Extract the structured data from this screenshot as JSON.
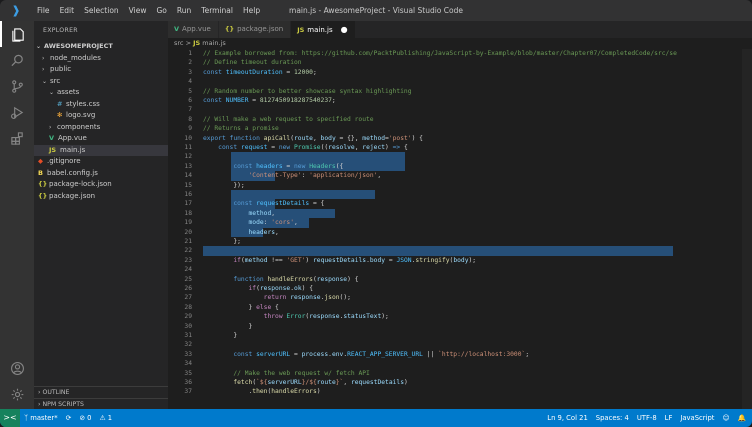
{
  "window": {
    "title": "main.js - AwesomeProject - Visual Studio Code",
    "menu": [
      "File",
      "Edit",
      "Selection",
      "View",
      "Go",
      "Run",
      "Terminal",
      "Help"
    ]
  },
  "sidebar": {
    "header": "EXPLORER",
    "root": "AWESOMEPROJECT",
    "items": [
      {
        "label": "node_modules",
        "type": "folder"
      },
      {
        "label": "public",
        "type": "folder"
      },
      {
        "label": "src",
        "type": "folder-open"
      },
      {
        "label": "assets",
        "type": "folder-open"
      },
      {
        "label": "styles.css",
        "type": "css"
      },
      {
        "label": "logo.svg",
        "type": "svg"
      },
      {
        "label": "components",
        "type": "folder"
      },
      {
        "label": "App.vue",
        "type": "vue"
      },
      {
        "label": "main.js",
        "type": "js"
      },
      {
        "label": ".gitignore",
        "type": "git"
      },
      {
        "label": "babel.config.js",
        "type": "babel"
      },
      {
        "label": "package-lock.json",
        "type": "json"
      },
      {
        "label": "package.json",
        "type": "json"
      }
    ],
    "outline": "OUTLINE",
    "npm_scripts": "NPM SCRIPTS"
  },
  "tabs": [
    {
      "label": "App.vue",
      "icon": "V",
      "active": false
    },
    {
      "label": "package.json",
      "icon": "{}",
      "active": false
    },
    {
      "label": "main.js",
      "icon": "JS",
      "active": true,
      "modified": true
    }
  ],
  "breadcrumb": {
    "folder": "src",
    "sep": ">",
    "file_icon": "JS",
    "file": "main.js"
  },
  "colors": {
    "accent": "#007acc",
    "selection": "#264f78",
    "remote": "#16825d"
  },
  "status": {
    "remote_icon": "><",
    "branch": "master*",
    "errors": "⊘ 0",
    "warnings": "⚠ 1",
    "position": "Ln 9, Col 21",
    "spaces": "Spaces: 4",
    "encoding": "UTF-8",
    "eol": "LF",
    "language": "JavaScript",
    "feedback_icon": "smiley-icon",
    "bell_icon": "bell-icon"
  }
}
